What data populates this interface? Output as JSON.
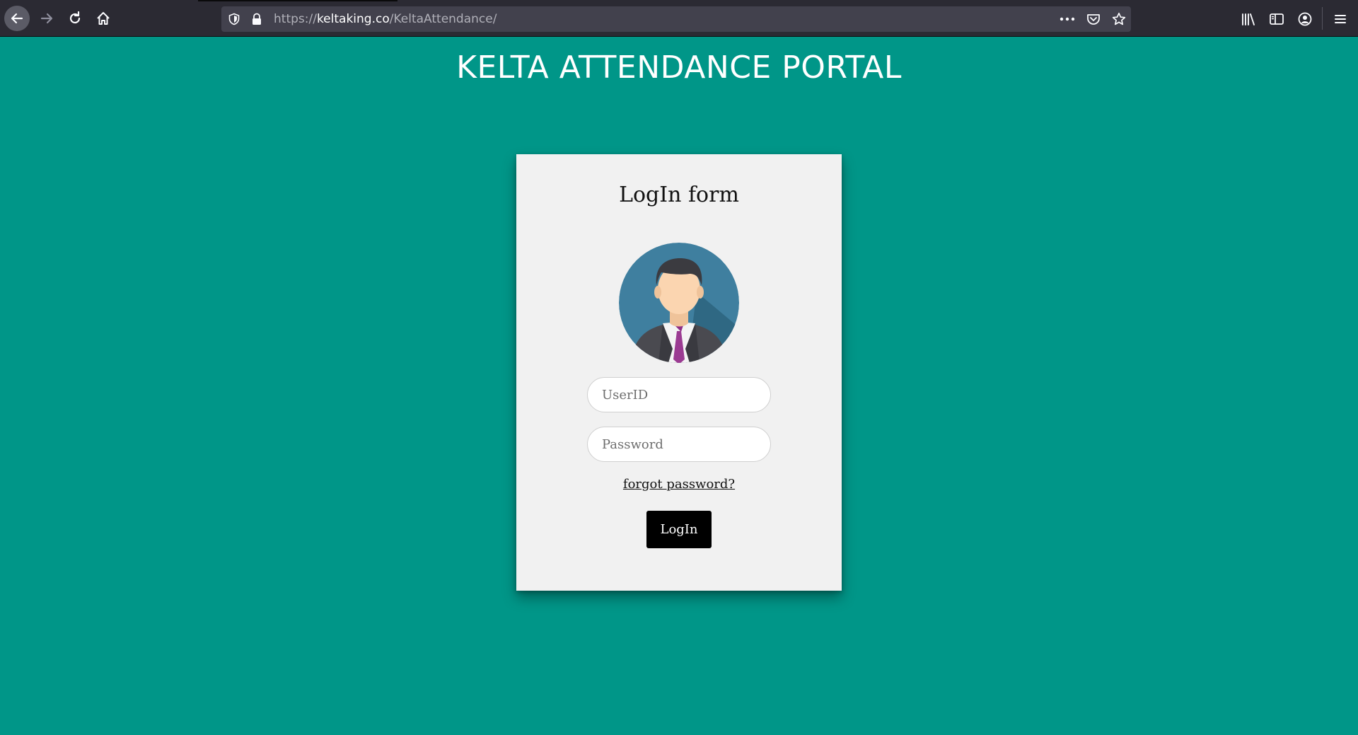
{
  "browser": {
    "url_prefix": "https://",
    "url_domain": "keltaking.co",
    "url_path": "/KeltaAttendance/",
    "icons": [
      "back-icon",
      "forward-icon",
      "reload-icon",
      "home-icon",
      "shield-icon",
      "lock-icon",
      "more-icon",
      "pocket-icon",
      "star-icon",
      "library-icon",
      "sidebar-icon",
      "account-icon",
      "menu-icon"
    ]
  },
  "page": {
    "title": "KELTA ATTENDANCE PORTAL",
    "background": "#009688"
  },
  "login": {
    "form_title": "LogIn form",
    "userid_placeholder": "UserID",
    "password_placeholder": "Password",
    "forgot_label": "forgot password?",
    "button_label": "LogIn",
    "button_color": "#000000",
    "avatar_icon": "user-avatar-icon"
  }
}
